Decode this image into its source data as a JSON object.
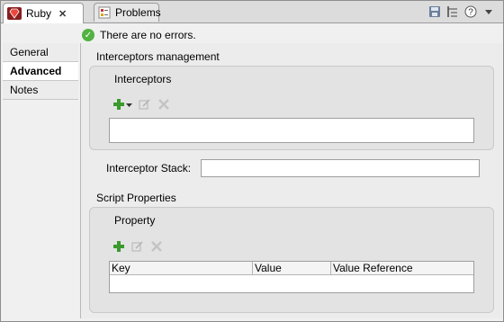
{
  "tabs": [
    {
      "label": "Ruby",
      "close": "✕"
    },
    {
      "label": "Problems"
    }
  ],
  "status": {
    "message": "There are no errors."
  },
  "nav": {
    "items": [
      "General",
      "Advanced",
      "Notes"
    ],
    "selected": "Advanced"
  },
  "interceptors_section": {
    "title": "Interceptors management",
    "group_label": "Interceptors",
    "stack_label": "Interceptor Stack:",
    "stack_value": ""
  },
  "script_section": {
    "title": "Script Properties",
    "group_label": "Property",
    "columns": [
      "Key",
      "Value",
      "Value Reference"
    ]
  },
  "colors": {
    "add": "#3a9a2c",
    "error_ok": "#52b241",
    "ruby": "#c8272b"
  }
}
